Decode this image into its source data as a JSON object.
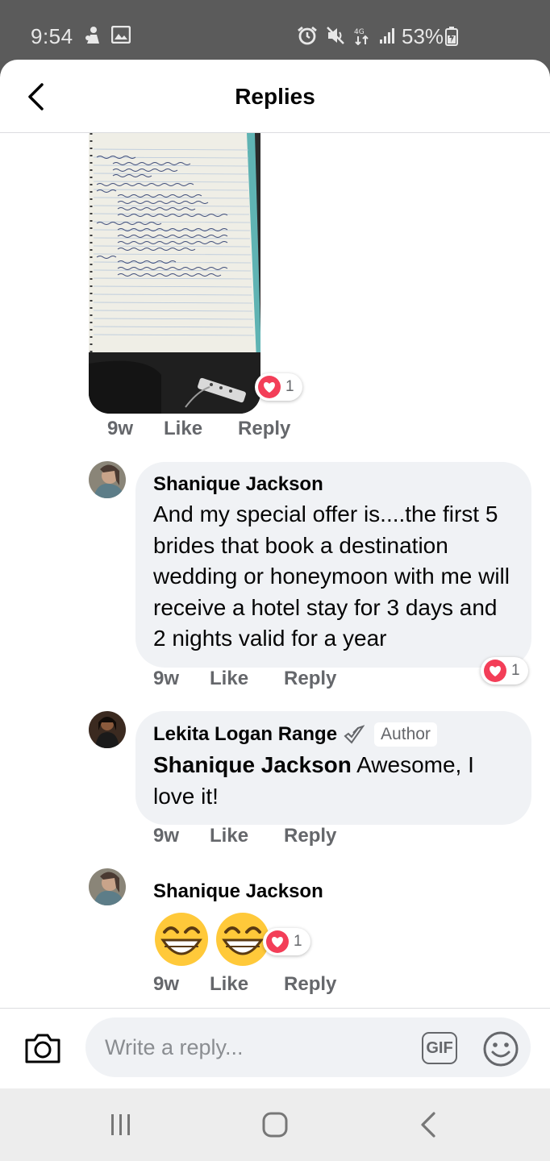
{
  "status_bar": {
    "time": "9:54",
    "battery": "53%"
  },
  "header": {
    "title": "Replies"
  },
  "comments": [
    {
      "time": "9w",
      "like": "Like",
      "reply": "Reply",
      "reaction_count": "1"
    },
    {
      "name": "Shanique Jackson",
      "text": "And my special offer is....the first 5 brides that book a destination wedding or honeymoon with me will receive a hotel stay for 3 days and 2 nights valid for a year",
      "time": "9w",
      "like": "Like",
      "reply": "Reply",
      "reaction_count": "1"
    },
    {
      "name": "Lekita Logan Range",
      "badge": "Author",
      "mention": "Shanique Jackson",
      "text": " Awesome, I love it!",
      "time": "9w",
      "like": "Like",
      "reply": "Reply"
    },
    {
      "name": "Shanique Jackson",
      "emoji": "😁😁",
      "time": "9w",
      "like": "Like",
      "reply": "Reply",
      "reaction_count": "1"
    }
  ],
  "composer": {
    "placeholder": "Write a reply...",
    "gif_label": "GIF"
  },
  "colors": {
    "accent_reaction": "#f33e58",
    "meta_text": "#65676b",
    "bubble": "#f0f2f5"
  },
  "icons": [
    "back-arrow-icon",
    "heart-icon",
    "camera-icon",
    "gif-icon",
    "smiley-icon",
    "recent-apps-icon",
    "home-icon",
    "nav-back-icon"
  ]
}
